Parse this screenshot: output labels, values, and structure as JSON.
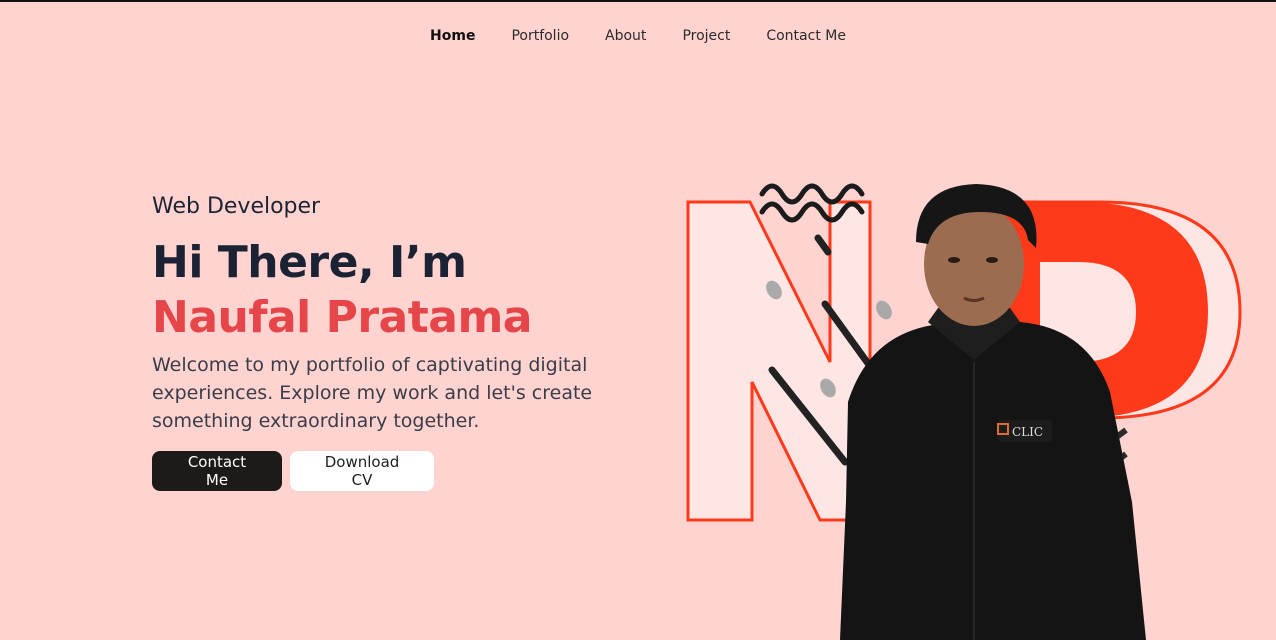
{
  "nav": {
    "items": [
      {
        "label": "Home",
        "active": true
      },
      {
        "label": "Portfolio",
        "active": false
      },
      {
        "label": "About",
        "active": false
      },
      {
        "label": "Project",
        "active": false
      },
      {
        "label": "Contact Me",
        "active": false
      }
    ]
  },
  "hero": {
    "role": "Web Developer",
    "greeting": "Hi There, I’m",
    "name": "Naufal Pratama",
    "description": "Welcome to my portfolio of captivating digital experiences. Explore my work and let's create something extraordinary together.",
    "primary_button": "Contact Me",
    "secondary_button": "Download CV"
  },
  "colors": {
    "background": "#ffd3d0",
    "accent": "#e6454a",
    "logo_red": "#ff3a1a",
    "dark_button": "#1e1a17"
  },
  "portrait": {
    "shirt_logo_text": "CLIC"
  }
}
